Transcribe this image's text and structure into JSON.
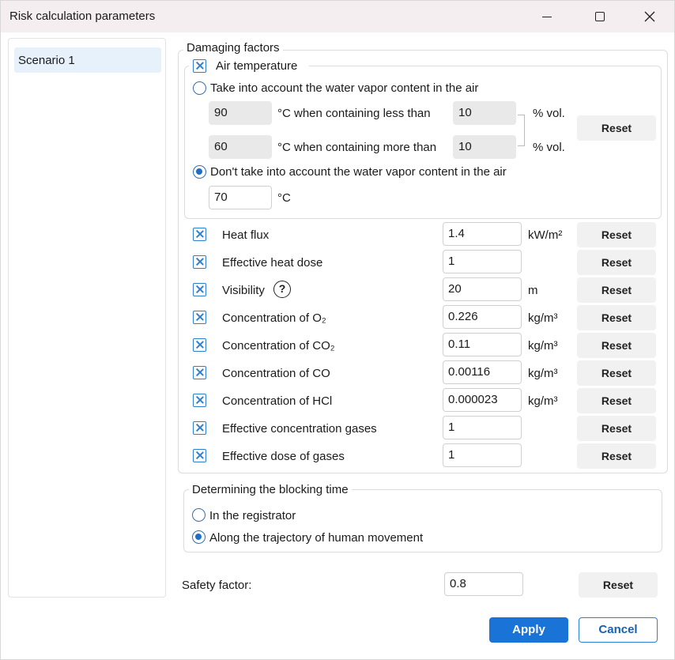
{
  "window": {
    "title": "Risk calculation parameters"
  },
  "sidebar": {
    "items": [
      {
        "label": "Scenario 1"
      }
    ]
  },
  "damaging": {
    "legend": "Damaging factors",
    "air": {
      "legend": "Air temperature",
      "option_vapor": "Take into account the water vapor content in the air",
      "temp_less": "90",
      "less_label": "°C when containing less than",
      "vol_less": "10",
      "temp_more": "60",
      "more_label": "°C when containing more than",
      "vol_more": "10",
      "vol_unit": "% vol.",
      "reset": "Reset",
      "option_no_vapor": "Don't take into account the water vapor content in the air",
      "temp_value": "70",
      "temp_unit": "°C"
    },
    "factors": [
      {
        "label": "Heat flux",
        "value": "1.4",
        "unit": "kW/m²",
        "reset": "Reset"
      },
      {
        "label": "Effective heat dose",
        "value": "1",
        "unit": "",
        "reset": "Reset"
      },
      {
        "label": "Visibility",
        "value": "20",
        "unit": "m",
        "reset": "Reset",
        "help": "?"
      },
      {
        "label": "Concentration of O₂",
        "value": "0.226",
        "unit": "kg/m³",
        "reset": "Reset"
      },
      {
        "label": "Concentration of CO₂",
        "value": "0.11",
        "unit": "kg/m³",
        "reset": "Reset"
      },
      {
        "label": "Concentration of CO",
        "value": "0.00116",
        "unit": "kg/m³",
        "reset": "Reset"
      },
      {
        "label": "Concentration of HCl",
        "value": "0.000023",
        "unit": "kg/m³",
        "reset": "Reset"
      },
      {
        "label": "Effective concentration gases",
        "value": "1",
        "unit": "",
        "reset": "Reset"
      },
      {
        "label": "Effective dose of gases",
        "value": "1",
        "unit": "",
        "reset": "Reset"
      }
    ]
  },
  "blocking": {
    "legend": "Determining the blocking time",
    "option_registrator": "In the registrator",
    "option_trajectory": "Along the trajectory of human movement"
  },
  "safety": {
    "label": "Safety factor:",
    "value": "0.8",
    "reset": "Reset"
  },
  "footer": {
    "apply": "Apply",
    "cancel": "Cancel"
  },
  "colors": {
    "accent": "#1a74d8",
    "checkbox": "#2f7fcf",
    "selected_item": "#e6f1fb"
  }
}
